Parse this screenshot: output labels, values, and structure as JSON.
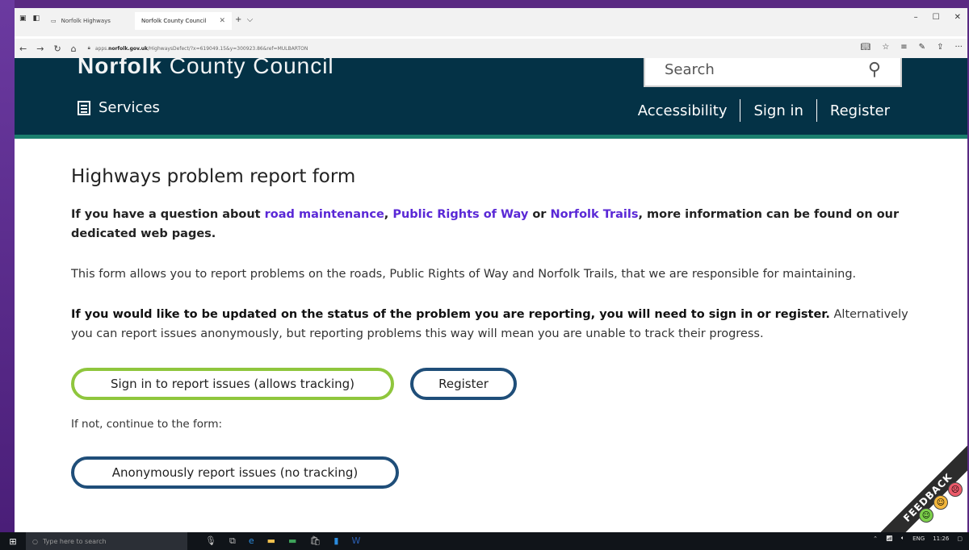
{
  "browser": {
    "tabs": [
      {
        "label": "Norfolk Highways"
      },
      {
        "label": "Norfolk County Council"
      }
    ],
    "url_prefix": "apps.",
    "url_domain": "norfolk.gov.uk",
    "url_path": "/HighwaysDefect/?x=619049.15&y=300923.86&ref=MULBARTON"
  },
  "header": {
    "logo_bold": "Norfolk",
    "logo_rest": " County Council",
    "search_placeholder": "Search",
    "services_label": "Services",
    "links": {
      "accessibility": "Accessibility",
      "sign_in": "Sign in",
      "register": "Register"
    }
  },
  "main": {
    "title": "Highways problem report form",
    "lead": {
      "part1": "If you have a question about ",
      "link1": "road maintenance",
      "comma": ", ",
      "link2": "Public Rights of Way",
      "or": " or ",
      "link3": "Norfolk Trails",
      "part2": ", more information can be found on our dedicated web pages."
    },
    "intro": "This form allows you to report problems on the roads, Public Rights of Way and Norfolk Trails, that we are responsible for maintaining.",
    "update_bold": "If you would like to be updated on the status of the problem you are reporting, you will need to sign in or register.",
    "update_rest": " Alternatively you can report issues anonymously, but reporting problems this way will mean you are unable to track their progress.",
    "buttons": {
      "sign_in": "Sign in to report issues (allows tracking)",
      "register": "Register",
      "anonymous": "Anonymously report issues (no tracking)"
    },
    "if_not": "If not, continue to the form:"
  },
  "feedback": {
    "label": "FEEDBACK"
  },
  "taskbar": {
    "search_placeholder": "Type here to search",
    "language": "ENG",
    "time": "11:26"
  }
}
